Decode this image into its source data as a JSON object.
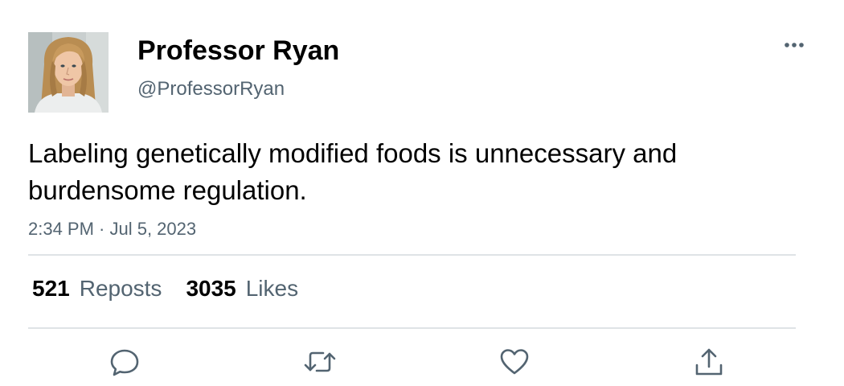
{
  "author": {
    "display_name": "Professor Ryan",
    "handle": "@ProfessorRyan",
    "avatar_icon": "profile-photo-woman-blonde"
  },
  "tweet": {
    "text": "Labeling genetically modified foods is unnecessary and burdensome regulation.",
    "timestamp": "2:34 PM · Jul 5, 2023"
  },
  "stats": {
    "reposts_count": "521",
    "reposts_label": "Reposts",
    "likes_count": "3035",
    "likes_label": "Likes"
  },
  "actions": [
    {
      "name": "reply",
      "icon": "speech-bubble-icon"
    },
    {
      "name": "repost",
      "icon": "repost-arrows-icon"
    },
    {
      "name": "like",
      "icon": "heart-icon"
    },
    {
      "name": "share",
      "icon": "share-upload-icon"
    }
  ],
  "colors": {
    "text_primary": "#000000",
    "text_secondary": "#536471",
    "divider": "#dfe3e6",
    "icon": "#536471"
  }
}
